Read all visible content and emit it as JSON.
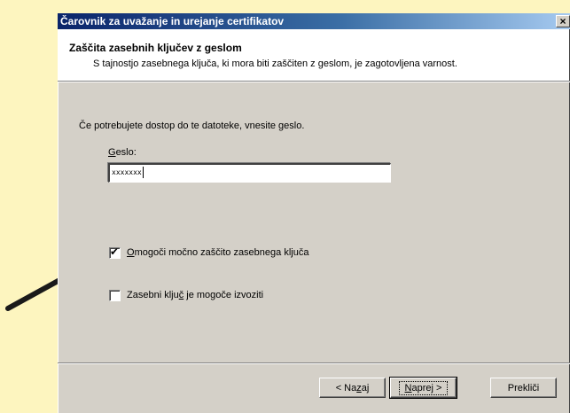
{
  "window": {
    "title": "Čarovnik za uvažanje in urejanje certifikatov",
    "close_glyph": "×"
  },
  "header": {
    "title": "Zaščita zasebnih ključev z geslom",
    "subtitle": "S tajnostjo zasebnega ključa, ki mora biti zaščiten z geslom, je zagotovljena varnost."
  },
  "body": {
    "instruction": "Če potrebujete dostop do te datoteke, vnesite geslo.",
    "password_label_accel": "G",
    "password_label_rest": "eslo:",
    "password_value": "xxxxxxx"
  },
  "options": [
    {
      "label_accel": "O",
      "label_rest": "mogoči močno zaščito zasebnega ključa",
      "checked": true,
      "check_glyph": "✔"
    },
    {
      "label_pre": "Zasebni klju",
      "label_accel": "č",
      "label_post": " je mogoče izvoziti",
      "checked": false
    }
  ],
  "buttons": {
    "back_pre": "< Na",
    "back_accel": "z",
    "back_post": "aj",
    "next_accel": "N",
    "next_post": "aprej >",
    "cancel": "Prekliči"
  },
  "colors": {
    "background": "#fdf5bf",
    "dialog": "#d4d0c8",
    "title_start": "#0a246a",
    "title_end": "#a6caf0",
    "arrow": "#1a1a1a"
  }
}
